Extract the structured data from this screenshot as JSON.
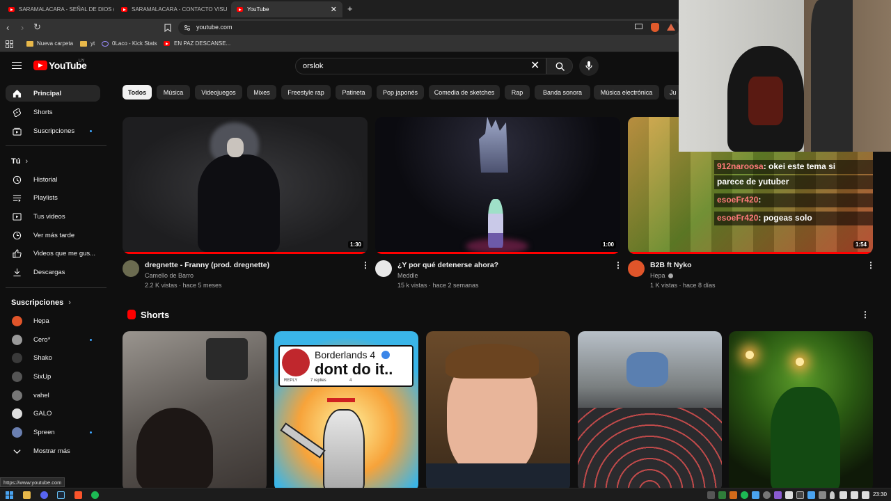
{
  "browser": {
    "tabs": [
      {
        "label": "SARAMALACARA - SEÑAL DE DIOS (",
        "active": false
      },
      {
        "label": "SARAMALACARA - CONTACTO VISU",
        "active": false
      },
      {
        "label": "YouTube",
        "active": true
      }
    ],
    "url": "youtube.com",
    "bookmarks": [
      "Nueva carpeta",
      "yt",
      "0Laco - Kick Stats",
      "EN PAZ DESCANSE..."
    ]
  },
  "header": {
    "logo_text": "YouTube",
    "country_code": "UY",
    "search_value": "orslok"
  },
  "sidebar": {
    "main": [
      {
        "label": "Principal",
        "icon": "home-icon",
        "active": true
      },
      {
        "label": "Shorts",
        "icon": "shorts-icon"
      },
      {
        "label": "Suscripciones",
        "icon": "subscriptions-icon",
        "dot": true
      }
    ],
    "you_heading": "Tú",
    "you_items": [
      {
        "label": "Historial",
        "icon": "history-icon"
      },
      {
        "label": "Playlists",
        "icon": "playlists-icon"
      },
      {
        "label": "Tus videos",
        "icon": "your-videos-icon"
      },
      {
        "label": "Ver más tarde",
        "icon": "watch-later-icon"
      },
      {
        "label": "Videos que me gus...",
        "icon": "liked-icon"
      },
      {
        "label": "Descargas",
        "icon": "download-icon"
      }
    ],
    "subs_heading": "Suscripciones",
    "subs": [
      {
        "label": "Hepa",
        "color": "#e0552a"
      },
      {
        "label": "Cero*",
        "color": "#9a9a9a",
        "dot": true
      },
      {
        "label": "Shako",
        "color": "#3a3a3a"
      },
      {
        "label": "SixUp",
        "color": "#555555"
      },
      {
        "label": "vahel",
        "color": "#777777"
      },
      {
        "label": "GALO",
        "color": "#dddddd"
      },
      {
        "label": "Spreen",
        "color": "#6a7fb0",
        "dot": true
      }
    ],
    "show_more": "Mostrar más"
  },
  "chips": [
    "Todos",
    "Música",
    "Videojuegos",
    "Mixes",
    "Freestyle rap",
    "Patineta",
    "Pop japonés",
    "Comedia de sketches",
    "Rap",
    "Banda sonora",
    "Música electrónica",
    "Ju"
  ],
  "videos": [
    {
      "title": "dregnette - Franny (prod. dregnette)",
      "channel": "Camello de Barro",
      "meta": "2.2 K vistas · hace 5 meses",
      "duration": "1:30",
      "avatar_color": "#6b6b50"
    },
    {
      "title": "¿Y por qué detenerse ahora?",
      "channel": "Meddle",
      "meta": "15 k vistas · hace 2 semanas",
      "duration": "1:00",
      "avatar_color": "#e8e8e8"
    },
    {
      "title": "B2B ft Nyko",
      "channel": "Hepa",
      "meta": "1 K vistas · hace 8 días",
      "duration": "1:54",
      "avatar_color": "#e0552a"
    }
  ],
  "thumb3_chat": [
    {
      "user": "912naroosa",
      "msg": ": okei este tema si"
    },
    {
      "user": "",
      "msg": "parece de yutuber"
    },
    {
      "user": "esoeFr420",
      "msg": ":"
    },
    {
      "user": "esoeFr420",
      "msg": ": pogeas solo"
    }
  ],
  "shorts": {
    "heading": "Shorts",
    "overlay_title": "Borderlands 4",
    "overlay_subtitle": "dont do it..",
    "overlay_reply": "REPLY",
    "overlay_replies": "7 replies",
    "overlay_likes": "4"
  },
  "status_url": "https://www.youtube.com",
  "clock": "23:30"
}
